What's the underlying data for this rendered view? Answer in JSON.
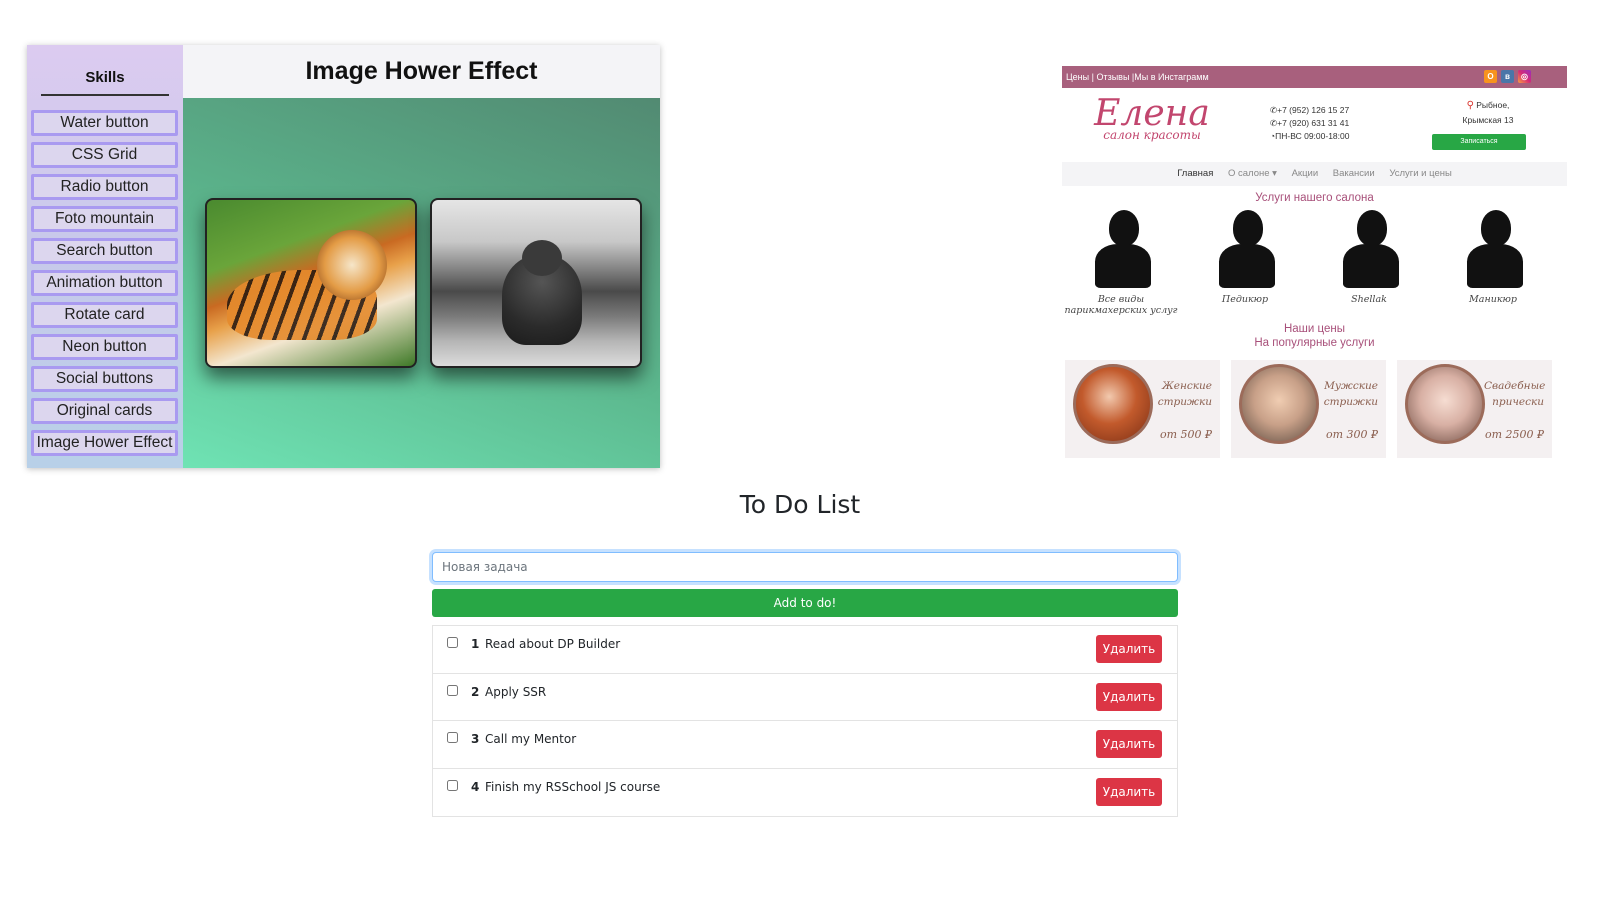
{
  "hover_demo": {
    "sidebar_title": "Skills",
    "skills": [
      "Water button",
      "CSS Grid",
      "Radio button",
      "Foto mountain",
      "Search button",
      "Animation button",
      "Rotate card",
      "Neon button",
      "Social buttons",
      "Original cards",
      "Image Hower Effect"
    ],
    "header_title": "Image Hower Effect",
    "images": [
      "tiger",
      "bear"
    ]
  },
  "salon": {
    "topbar_links": "Цены | Отзывы |Мы в Инстаграмм",
    "social_icons": [
      "odnoklassniki-icon",
      "vk-icon",
      "instagram-icon"
    ],
    "logo_name": "Елена",
    "logo_sub": "салон красоты",
    "phone_1": "+7 (952) 126 15 27",
    "phone_2": "+7 (920) 631 31 41",
    "hours": "ПН-ВС 09:00-18:00",
    "address_line1": "Рыбное,",
    "address_line2": "Крымская 13",
    "book_button": "Записаться",
    "nav": {
      "home": "Главная",
      "about": "О салоне ▾",
      "promo": "Акции",
      "jobs": "Вакансии",
      "services": "Услуги и цены"
    },
    "services_title": "Услуги нашего салона",
    "services": [
      "Все виды парикмахерских услуг",
      "Педикюр",
      "Shellak",
      "Маникюр"
    ],
    "prices_title_1": "Наши цены",
    "prices_title_2": "На популярные услуги",
    "prices": [
      {
        "name": "Женские стрижки",
        "cost": "от 500 ₽"
      },
      {
        "name": "Мужские стрижки",
        "cost": "от 300 ₽"
      },
      {
        "name": "Свадебные прически",
        "cost": "от 2500 ₽"
      }
    ]
  },
  "todo": {
    "title": "To Do List",
    "input_placeholder": "Новая задача",
    "add_button": "Add to do!",
    "delete_label": "Удалить",
    "items": [
      {
        "num": "1",
        "text": "Read about DP Builder",
        "done": false
      },
      {
        "num": "2",
        "text": "Apply SSR",
        "done": false
      },
      {
        "num": "3",
        "text": "Call my Mentor",
        "done": false
      },
      {
        "num": "4",
        "text": "Finish my RSSchool JS course",
        "done": false
      }
    ]
  }
}
